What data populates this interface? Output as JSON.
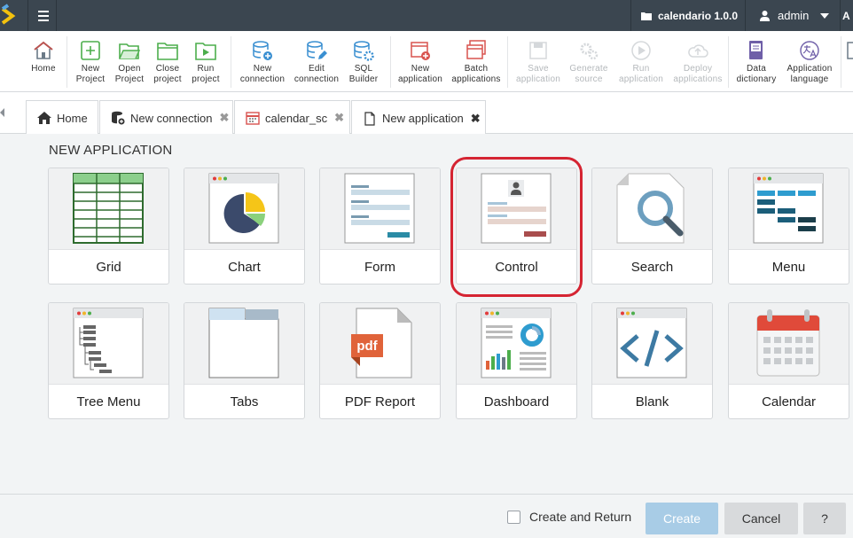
{
  "topbar": {
    "project": "calendario 1.0.0",
    "user": "admin",
    "cut_label": "A"
  },
  "toolbar": {
    "home": "Home",
    "new_project": [
      "New",
      "Project"
    ],
    "open_project": [
      "Open",
      "Project"
    ],
    "close_project": [
      "Close",
      "project"
    ],
    "run_project": [
      "Run",
      "project"
    ],
    "new_connection": [
      "New",
      "connection"
    ],
    "edit_connection": [
      "Edit",
      "connection"
    ],
    "sql_builder": [
      "SQL",
      "Builder"
    ],
    "new_application": [
      "New",
      "application"
    ],
    "batch_applications": [
      "Batch",
      "applications"
    ],
    "save_application": [
      "Save",
      "application"
    ],
    "generate_source": [
      "Generate",
      "source"
    ],
    "run_application": [
      "Run",
      "application"
    ],
    "deploy_applications": [
      "Deploy",
      "applications"
    ],
    "data_dictionary": [
      "Data",
      "dictionary"
    ],
    "application_language": [
      "Application",
      "language"
    ]
  },
  "tabs": [
    {
      "label": "Home"
    },
    {
      "label": "New connection"
    },
    {
      "label": "calendar_sc"
    },
    {
      "label": "New application"
    }
  ],
  "page": {
    "heading": "NEW APPLICATION"
  },
  "apps": [
    {
      "label": "Grid"
    },
    {
      "label": "Chart"
    },
    {
      "label": "Form"
    },
    {
      "label": "Control"
    },
    {
      "label": "Search"
    },
    {
      "label": "Menu"
    },
    {
      "label": "Tree Menu"
    },
    {
      "label": "Tabs"
    },
    {
      "label": "PDF Report"
    },
    {
      "label": "Dashboard"
    },
    {
      "label": "Blank"
    },
    {
      "label": "Calendar"
    }
  ],
  "highlighted_app": "Control",
  "footer": {
    "create_and_return": "Create and Return",
    "create": "Create",
    "cancel": "Cancel",
    "help": "?"
  },
  "colors": {
    "topbar": "#3b4650",
    "accent_green": "#4cae4c",
    "highlight": "#d52432",
    "create_btn": "#a8cce6"
  }
}
